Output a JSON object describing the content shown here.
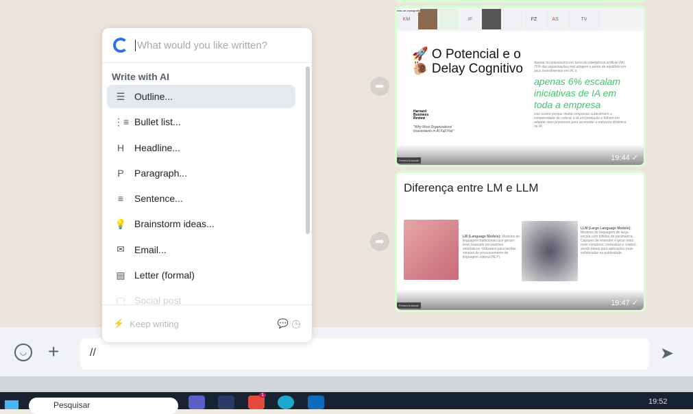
{
  "popup": {
    "placeholder": "What would you like written?",
    "section": "Write with AI",
    "items": [
      {
        "icon": "outline-icon",
        "glyph": "☰",
        "label": "Outline..."
      },
      {
        "icon": "bullet-list-icon",
        "glyph": "⋮≡",
        "label": "Bullet list..."
      },
      {
        "icon": "headline-icon",
        "glyph": "H",
        "label": "Headline..."
      },
      {
        "icon": "paragraph-icon",
        "glyph": "P",
        "label": "Paragraph..."
      },
      {
        "icon": "sentence-icon",
        "glyph": "≡",
        "label": "Sentence..."
      },
      {
        "icon": "lightbulb-icon",
        "glyph": "💡",
        "label": "Brainstorm ideas..."
      },
      {
        "icon": "envelope-icon",
        "glyph": "✉",
        "label": "Email..."
      },
      {
        "icon": "document-icon",
        "glyph": "▤",
        "label": "Letter (formal)"
      },
      {
        "icon": "social-icon",
        "glyph": "▢",
        "label": "Social post"
      }
    ],
    "keep_writing": "Keep writing"
  },
  "messages": [
    {
      "participants": [
        "KM",
        "",
        "",
        "IF",
        "",
        "",
        "FZ",
        "AS",
        "TV"
      ],
      "banner": "etas de criptografia",
      "title_line1": "🚀 O Potencial e o",
      "title_line2": "🐌 Delay Cognitivo",
      "body": "Apesar do entusiasmo em torno da inteligência artificial (IA), 76% das organizações mal atingem o ponto de equilíbrio em seus investimentos em IA, e",
      "highlight": "apenas 6% escalam iniciativas de IA em toda a empresa",
      "body2": "Isso ocorre porque muitas empresas subestimam a complexidade de colocar a IA em produção e falham em adaptar seus processos para acomodar a natureza dinâmica da IA.",
      "source": "Harvard Business Review",
      "quote": "\"Why Most Organizations' Investments in AI Fall Flat\"",
      "presenter": "Pereira Andrade",
      "time": "19:44"
    },
    {
      "title": "Diferença entre LM e LLM",
      "lm_title": "LM (Language Models):",
      "lm_body": "Modelos de linguagem tradicionais que geram texto baseado em padrões estatísticos. Utilizados para tarefas simples de processamento de linguagem natural (NLP).",
      "llm_title": "LLM (Large Language Models):",
      "llm_body": "Modelos de linguagem de larga escala com bilhões de parâmetros. Capazes de entender e gerar texto mais complexo, contextual e criativo, sendo ideais para aplicações mais sofisticadas na publicidade.",
      "presenter": "Pereira Andrade",
      "time": "19:47"
    }
  ],
  "composer": {
    "value": "//"
  },
  "taskbar": {
    "search": "Pesquisar",
    "clock": "19:52",
    "chrome_badge": "1"
  },
  "colors": {
    "accent_green": "#d9fdd3",
    "highlight_green": "#3ec46d",
    "taskbar": "#172333"
  }
}
